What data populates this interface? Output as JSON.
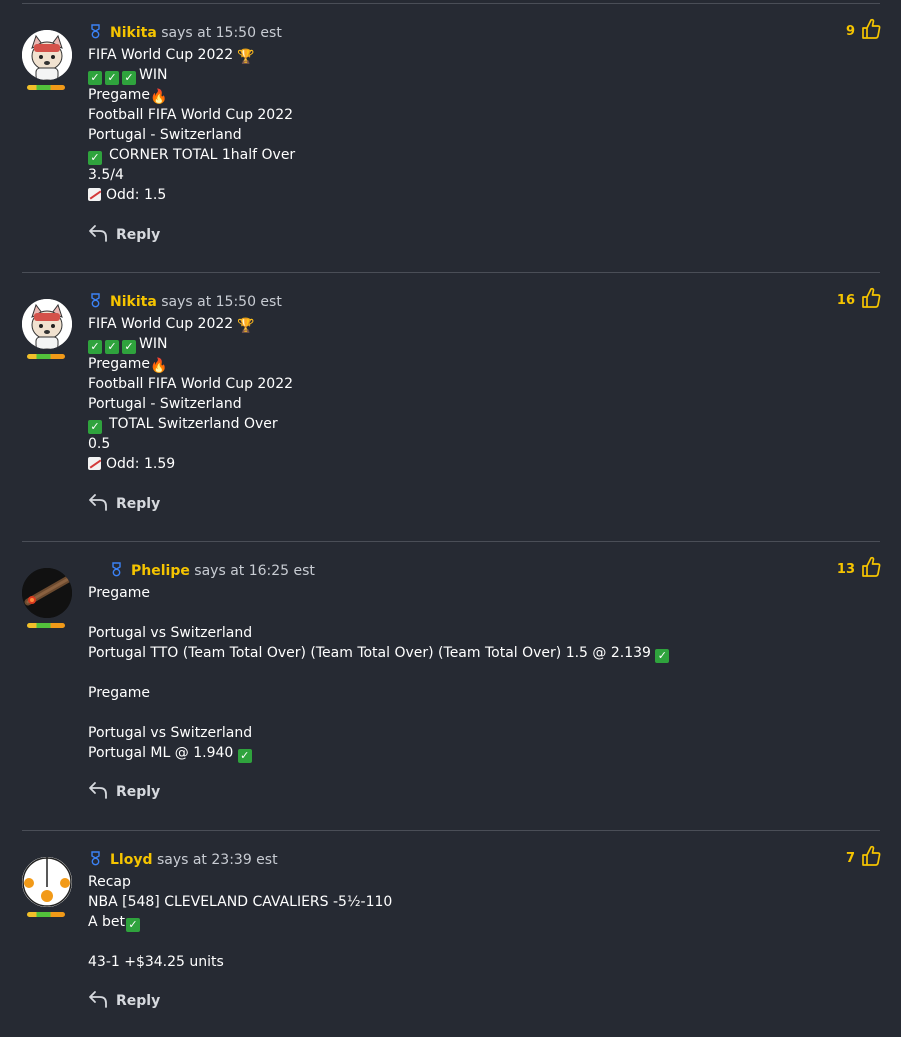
{
  "colors": {
    "background": "#262a33",
    "author": "#f5c400",
    "likes": "#f5c400",
    "divider": "#4a4e57"
  },
  "comments": [
    {
      "author": "Nikita",
      "says_at": "says at 15:50 est",
      "likes": "9",
      "reply": "Reply",
      "avatar": "cartoon-dog-avatar",
      "lines": [
        {
          "text": "FIFA World Cup 2022",
          "suffix": "trophy-icon"
        },
        {
          "text": "WIN",
          "prefix": "check-check-check"
        },
        {
          "text": "Pregame",
          "suffix": "fire-icon"
        },
        {
          "text": "Football FIFA World Cup 2022"
        },
        {
          "text": "Portugal - Switzerland"
        },
        {
          "text": "CORNER TOTAL 1half Over",
          "prefix": "check"
        },
        {
          "text": "3.5/4"
        },
        {
          "text": "Odd: 1.5",
          "prefix": "chart-icon"
        }
      ]
    },
    {
      "author": "Nikita",
      "says_at": "says at 15:50 est",
      "likes": "16",
      "reply": "Reply",
      "avatar": "cartoon-dog-avatar",
      "lines": [
        {
          "text": "FIFA World Cup 2022",
          "suffix": "trophy-icon"
        },
        {
          "text": "WIN",
          "prefix": "check-check-check"
        },
        {
          "text": "Pregame",
          "suffix": "fire-icon"
        },
        {
          "text": "Football FIFA World Cup 2022"
        },
        {
          "text": "Portugal - Switzerland"
        },
        {
          "text": "TOTAL Switzerland Over",
          "prefix": "check"
        },
        {
          "text": "0.5"
        },
        {
          "text": "Odd: 1.59",
          "prefix": "chart-icon"
        }
      ]
    },
    {
      "author": "Phelipe",
      "says_at": "says at 16:25 est",
      "likes": "13",
      "reply": "Reply",
      "avatar": "cigar-avatar",
      "lines": [
        {
          "text": "Pregame"
        },
        {
          "text": ""
        },
        {
          "text": "Portugal vs Switzerland"
        },
        {
          "text": "Portugal TTO (Team Total Over) (Team Total Over) (Team Total Over) 1.5 @ 2.139",
          "suffix": "check"
        },
        {
          "text": ""
        },
        {
          "text": "Pregame"
        },
        {
          "text": ""
        },
        {
          "text": "Portugal vs Switzerland"
        },
        {
          "text": "Portugal ML @ 1.940",
          "suffix": "check"
        }
      ]
    },
    {
      "author": "Lloyd",
      "says_at": "says at 23:39 est",
      "likes": "7",
      "reply": "Reply",
      "avatar": "orange-dots-avatar",
      "lines": [
        {
          "text": "Recap"
        },
        {
          "text": "NBA [548] CLEVELAND CAVALIERS -5½-110"
        },
        {
          "text": "A bet",
          "suffix": "check"
        },
        {
          "text": ""
        },
        {
          "text": "43-1 +$34.25 units"
        }
      ]
    }
  ]
}
